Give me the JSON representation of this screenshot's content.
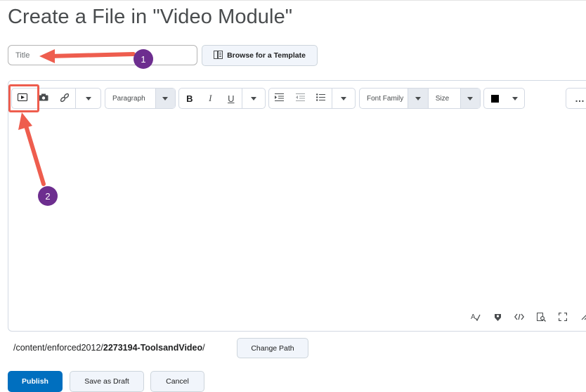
{
  "page": {
    "title": "Create a File in \"Video Module\""
  },
  "title_field": {
    "placeholder": "Title"
  },
  "template_button": {
    "label": "Browse for a Template"
  },
  "toolbar": {
    "paragraph_label": "Paragraph",
    "bold": "B",
    "italic": "I",
    "underline": "U",
    "font_family_label": "Font Famil​y",
    "size_label": "Size",
    "color": "#000000",
    "more": "…"
  },
  "path": {
    "prefix": "/content/enforced2012/",
    "folder": "2273194-ToolsandVideo",
    "suffix": "/"
  },
  "change_path_button": {
    "label": "Change Path"
  },
  "actions": {
    "publish_label": "Publish",
    "draft_label": "Save as Draft",
    "cancel_label": "Cancel"
  },
  "annotations": {
    "callout_1": "1",
    "callout_2": "2"
  },
  "colors": {
    "accent": "#006fbf",
    "highlight": "#ee5d4e",
    "callout": "#6d2e8f"
  }
}
